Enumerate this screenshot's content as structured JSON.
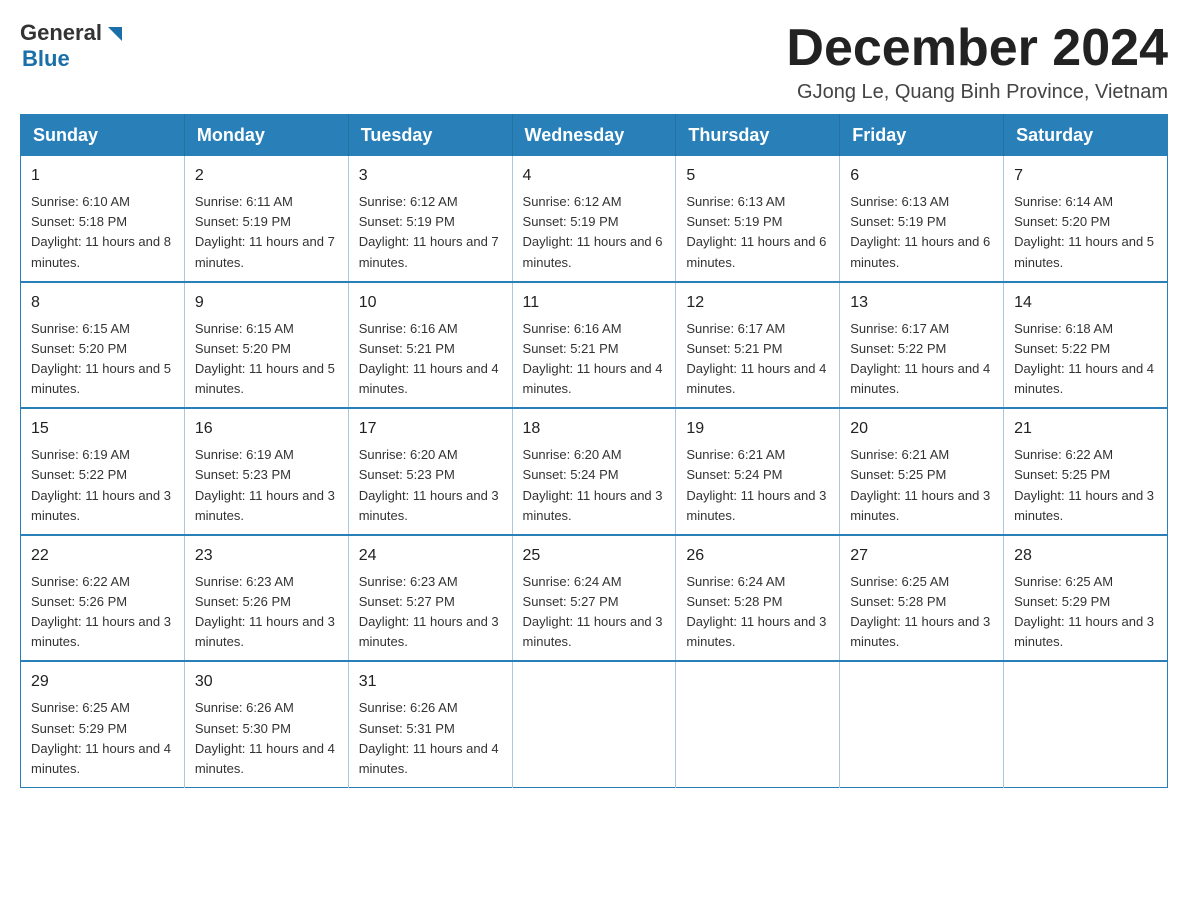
{
  "header": {
    "logo_general": "General",
    "logo_blue": "Blue",
    "month_title": "December 2024",
    "location": "GJong Le, Quang Binh Province, Vietnam"
  },
  "weekdays": [
    "Sunday",
    "Monday",
    "Tuesday",
    "Wednesday",
    "Thursday",
    "Friday",
    "Saturday"
  ],
  "weeks": [
    [
      {
        "day": "1",
        "sunrise": "6:10 AM",
        "sunset": "5:18 PM",
        "daylight": "11 hours and 8 minutes."
      },
      {
        "day": "2",
        "sunrise": "6:11 AM",
        "sunset": "5:19 PM",
        "daylight": "11 hours and 7 minutes."
      },
      {
        "day": "3",
        "sunrise": "6:12 AM",
        "sunset": "5:19 PM",
        "daylight": "11 hours and 7 minutes."
      },
      {
        "day": "4",
        "sunrise": "6:12 AM",
        "sunset": "5:19 PM",
        "daylight": "11 hours and 6 minutes."
      },
      {
        "day": "5",
        "sunrise": "6:13 AM",
        "sunset": "5:19 PM",
        "daylight": "11 hours and 6 minutes."
      },
      {
        "day": "6",
        "sunrise": "6:13 AM",
        "sunset": "5:19 PM",
        "daylight": "11 hours and 6 minutes."
      },
      {
        "day": "7",
        "sunrise": "6:14 AM",
        "sunset": "5:20 PM",
        "daylight": "11 hours and 5 minutes."
      }
    ],
    [
      {
        "day": "8",
        "sunrise": "6:15 AM",
        "sunset": "5:20 PM",
        "daylight": "11 hours and 5 minutes."
      },
      {
        "day": "9",
        "sunrise": "6:15 AM",
        "sunset": "5:20 PM",
        "daylight": "11 hours and 5 minutes."
      },
      {
        "day": "10",
        "sunrise": "6:16 AM",
        "sunset": "5:21 PM",
        "daylight": "11 hours and 4 minutes."
      },
      {
        "day": "11",
        "sunrise": "6:16 AM",
        "sunset": "5:21 PM",
        "daylight": "11 hours and 4 minutes."
      },
      {
        "day": "12",
        "sunrise": "6:17 AM",
        "sunset": "5:21 PM",
        "daylight": "11 hours and 4 minutes."
      },
      {
        "day": "13",
        "sunrise": "6:17 AM",
        "sunset": "5:22 PM",
        "daylight": "11 hours and 4 minutes."
      },
      {
        "day": "14",
        "sunrise": "6:18 AM",
        "sunset": "5:22 PM",
        "daylight": "11 hours and 4 minutes."
      }
    ],
    [
      {
        "day": "15",
        "sunrise": "6:19 AM",
        "sunset": "5:22 PM",
        "daylight": "11 hours and 3 minutes."
      },
      {
        "day": "16",
        "sunrise": "6:19 AM",
        "sunset": "5:23 PM",
        "daylight": "11 hours and 3 minutes."
      },
      {
        "day": "17",
        "sunrise": "6:20 AM",
        "sunset": "5:23 PM",
        "daylight": "11 hours and 3 minutes."
      },
      {
        "day": "18",
        "sunrise": "6:20 AM",
        "sunset": "5:24 PM",
        "daylight": "11 hours and 3 minutes."
      },
      {
        "day": "19",
        "sunrise": "6:21 AM",
        "sunset": "5:24 PM",
        "daylight": "11 hours and 3 minutes."
      },
      {
        "day": "20",
        "sunrise": "6:21 AM",
        "sunset": "5:25 PM",
        "daylight": "11 hours and 3 minutes."
      },
      {
        "day": "21",
        "sunrise": "6:22 AM",
        "sunset": "5:25 PM",
        "daylight": "11 hours and 3 minutes."
      }
    ],
    [
      {
        "day": "22",
        "sunrise": "6:22 AM",
        "sunset": "5:26 PM",
        "daylight": "11 hours and 3 minutes."
      },
      {
        "day": "23",
        "sunrise": "6:23 AM",
        "sunset": "5:26 PM",
        "daylight": "11 hours and 3 minutes."
      },
      {
        "day": "24",
        "sunrise": "6:23 AM",
        "sunset": "5:27 PM",
        "daylight": "11 hours and 3 minutes."
      },
      {
        "day": "25",
        "sunrise": "6:24 AM",
        "sunset": "5:27 PM",
        "daylight": "11 hours and 3 minutes."
      },
      {
        "day": "26",
        "sunrise": "6:24 AM",
        "sunset": "5:28 PM",
        "daylight": "11 hours and 3 minutes."
      },
      {
        "day": "27",
        "sunrise": "6:25 AM",
        "sunset": "5:28 PM",
        "daylight": "11 hours and 3 minutes."
      },
      {
        "day": "28",
        "sunrise": "6:25 AM",
        "sunset": "5:29 PM",
        "daylight": "11 hours and 3 minutes."
      }
    ],
    [
      {
        "day": "29",
        "sunrise": "6:25 AM",
        "sunset": "5:29 PM",
        "daylight": "11 hours and 4 minutes."
      },
      {
        "day": "30",
        "sunrise": "6:26 AM",
        "sunset": "5:30 PM",
        "daylight": "11 hours and 4 minutes."
      },
      {
        "day": "31",
        "sunrise": "6:26 AM",
        "sunset": "5:31 PM",
        "daylight": "11 hours and 4 minutes."
      },
      null,
      null,
      null,
      null
    ]
  ]
}
